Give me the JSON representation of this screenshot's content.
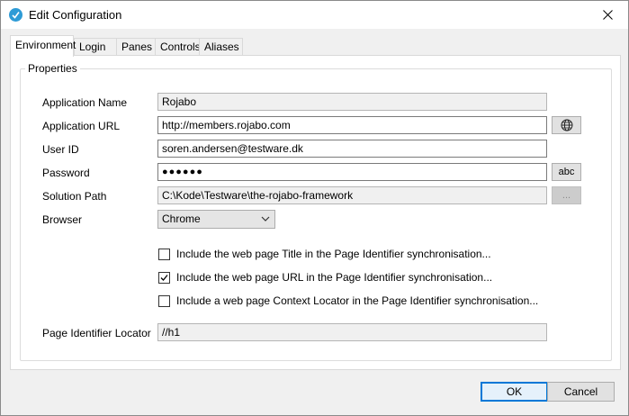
{
  "window": {
    "title": "Edit Configuration"
  },
  "tabs": [
    {
      "label": "Environment",
      "active": true
    },
    {
      "label": "Login"
    },
    {
      "label": "Panes"
    },
    {
      "label": "Controls"
    },
    {
      "label": "Aliases"
    }
  ],
  "properties": {
    "group_title": "Properties",
    "app_name_label": "Application Name",
    "app_name_value": "Rojabo",
    "app_url_label": "Application URL",
    "app_url_value": "http://members.rojabo.com",
    "user_id_label": "User ID",
    "user_id_value": "soren.andersen@testware.dk",
    "password_label": "Password",
    "password_mask": "●●●●●●",
    "show_password_label": "abc",
    "solution_path_label": "Solution Path",
    "solution_path_value": "C:\\Kode\\Testware\\the-rojabo-framework",
    "browse_label": "...",
    "browser_label": "Browser",
    "browser_value": "Chrome",
    "page_locator_label": "Page Identifier Locator",
    "page_locator_value": "//h1"
  },
  "sync_options": [
    {
      "label": "Include the web page Title in the Page Identifier synchronisation...",
      "checked": false
    },
    {
      "label": "Include the web page URL in the Page Identifier synchronisation...",
      "checked": true
    },
    {
      "label": "Include a web page Context Locator in the Page Identifier synchronisation...",
      "checked": false
    }
  ],
  "buttons": {
    "ok": "OK",
    "cancel": "Cancel"
  },
  "icons": {
    "app": "app-icon",
    "close": "close-icon",
    "globe": "globe-icon",
    "chevron": "chevron-down-icon",
    "check": "checkmark-icon"
  },
  "colors": {
    "accent": "#0078d7",
    "app_icon": "#2e9bd6"
  }
}
